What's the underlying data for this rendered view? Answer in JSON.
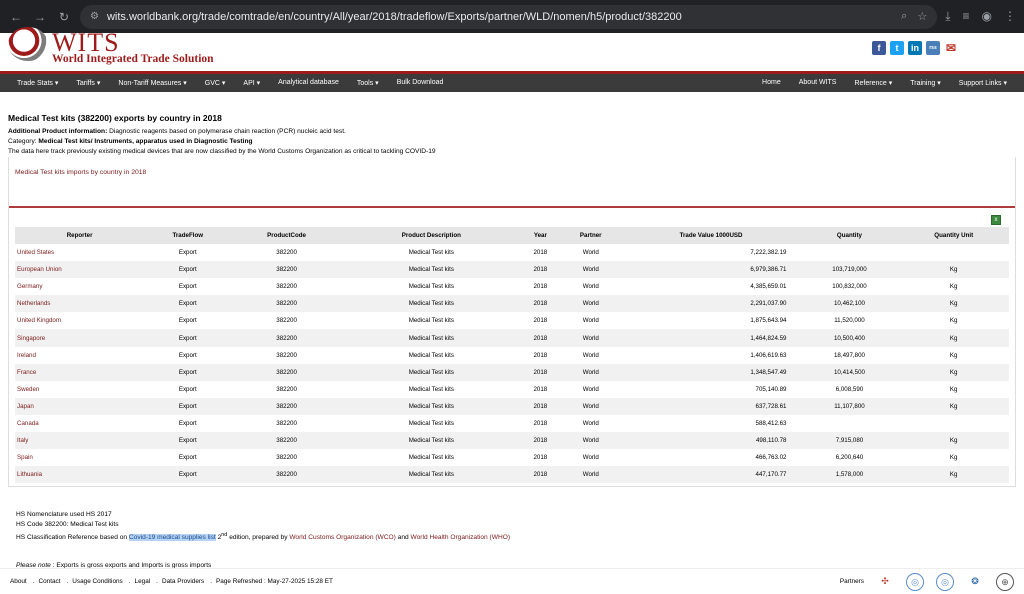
{
  "browser": {
    "url": "wits.worldbank.org/trade/comtrade/en/country/All/year/2018/tradeflow/Exports/partner/WLD/nomen/h5/product/382200"
  },
  "header": {
    "logo_text": "WITS",
    "logo_subtitle": "World Integrated Trade Solution",
    "social": [
      "f",
      "t",
      "in",
      "rss",
      "✉"
    ]
  },
  "menu": {
    "left": [
      "Trade Stats ▾",
      "Tariffs ▾",
      "Non-Tariff Measures ▾",
      "GVC ▾",
      "API ▾",
      "Analytical database",
      "Tools ▾",
      "Bulk Download"
    ],
    "right": [
      "Home",
      "About WITS",
      "Reference ▾",
      "Training ▾",
      "Support Links ▾"
    ]
  },
  "page": {
    "title": "Medical Test kits (382200) exports by country in 2018",
    "additional_label": "Additional Product information:",
    "additional_text": " Diagnostic reagents based on polymerase chain reaction (PCR) nucleic acid test.",
    "category_label": "Category: ",
    "category_text": "Medical Test kits/ Instruments, apparatus used in Diagnostic Testing",
    "description": "The data here track previously existing medical devices that are now classified by the World Customs Organization as critical to tackling COVID-19",
    "imports_link": "Medical Test kits imports by country in 2018"
  },
  "table": {
    "headers": [
      "Reporter",
      "TradeFlow",
      "ProductCode",
      "Product Description",
      "Year",
      "Partner",
      "Trade Value 1000USD",
      "Quantity",
      "Quantity Unit"
    ],
    "rows": [
      [
        "United States",
        "Export",
        "382200",
        "Medical Test kits",
        "2018",
        "World",
        "7,222,382.19",
        "",
        ""
      ],
      [
        "European Union",
        "Export",
        "382200",
        "Medical Test kits",
        "2018",
        "World",
        "6,979,386.71",
        "103,719,000",
        "Kg"
      ],
      [
        "Germany",
        "Export",
        "382200",
        "Medical Test kits",
        "2018",
        "World",
        "4,385,659.01",
        "100,832,000",
        "Kg"
      ],
      [
        "Netherlands",
        "Export",
        "382200",
        "Medical Test kits",
        "2018",
        "World",
        "2,291,037.90",
        "10,462,100",
        "Kg"
      ],
      [
        "United Kingdom",
        "Export",
        "382200",
        "Medical Test kits",
        "2018",
        "World",
        "1,875,643.94",
        "11,520,000",
        "Kg"
      ],
      [
        "Singapore",
        "Export",
        "382200",
        "Medical Test kits",
        "2018",
        "World",
        "1,464,824.59",
        "10,500,400",
        "Kg"
      ],
      [
        "Ireland",
        "Export",
        "382200",
        "Medical Test kits",
        "2018",
        "World",
        "1,406,619.63",
        "18,497,800",
        "Kg"
      ],
      [
        "France",
        "Export",
        "382200",
        "Medical Test kits",
        "2018",
        "World",
        "1,348,547.49",
        "10,414,500",
        "Kg"
      ],
      [
        "Sweden",
        "Export",
        "382200",
        "Medical Test kits",
        "2018",
        "World",
        "705,140.89",
        "6,008,590",
        "Kg"
      ],
      [
        "Japan",
        "Export",
        "382200",
        "Medical Test kits",
        "2018",
        "World",
        "637,728.61",
        "11,107,800",
        "Kg"
      ],
      [
        "Canada",
        "Export",
        "382200",
        "Medical Test kits",
        "2018",
        "World",
        "588,412.63",
        "",
        ""
      ],
      [
        "Italy",
        "Export",
        "382200",
        "Medical Test kits",
        "2018",
        "World",
        "498,110.78",
        "7,915,080",
        "Kg"
      ],
      [
        "Spain",
        "Export",
        "382200",
        "Medical Test kits",
        "2018",
        "World",
        "466,763.02",
        "6,200,640",
        "Kg"
      ],
      [
        "Lithuania",
        "Export",
        "382200",
        "Medical Test kits",
        "2018",
        "World",
        "447,170.77",
        "1,578,000",
        "Kg"
      ]
    ]
  },
  "notes": {
    "nomenclature": "HS Nomenclature used HS 2017",
    "hs_code": "HS Code 382200: Medical Test kits",
    "classification_prefix": "HS Classification Reference based on ",
    "classification_link": "Covid-19 medical supplies list",
    "classification_edition": " 2",
    "classification_sup": "nd",
    "classification_mid": " edition, prepared by ",
    "wco": "World Customs Organization (WCO)",
    "and": " and ",
    "who": "World Health Organization (WHO)",
    "please_note_label": "Please note",
    "please_note_text": " : Exports is gross exports and Imports is gross imports"
  },
  "footer": {
    "links": [
      "About",
      "Contact",
      "Usage Conditions",
      "Legal",
      "Data Providers"
    ],
    "refreshed": "Page Refreshed : May-27-2025 15:28 ET",
    "partners_label": "Partners"
  }
}
